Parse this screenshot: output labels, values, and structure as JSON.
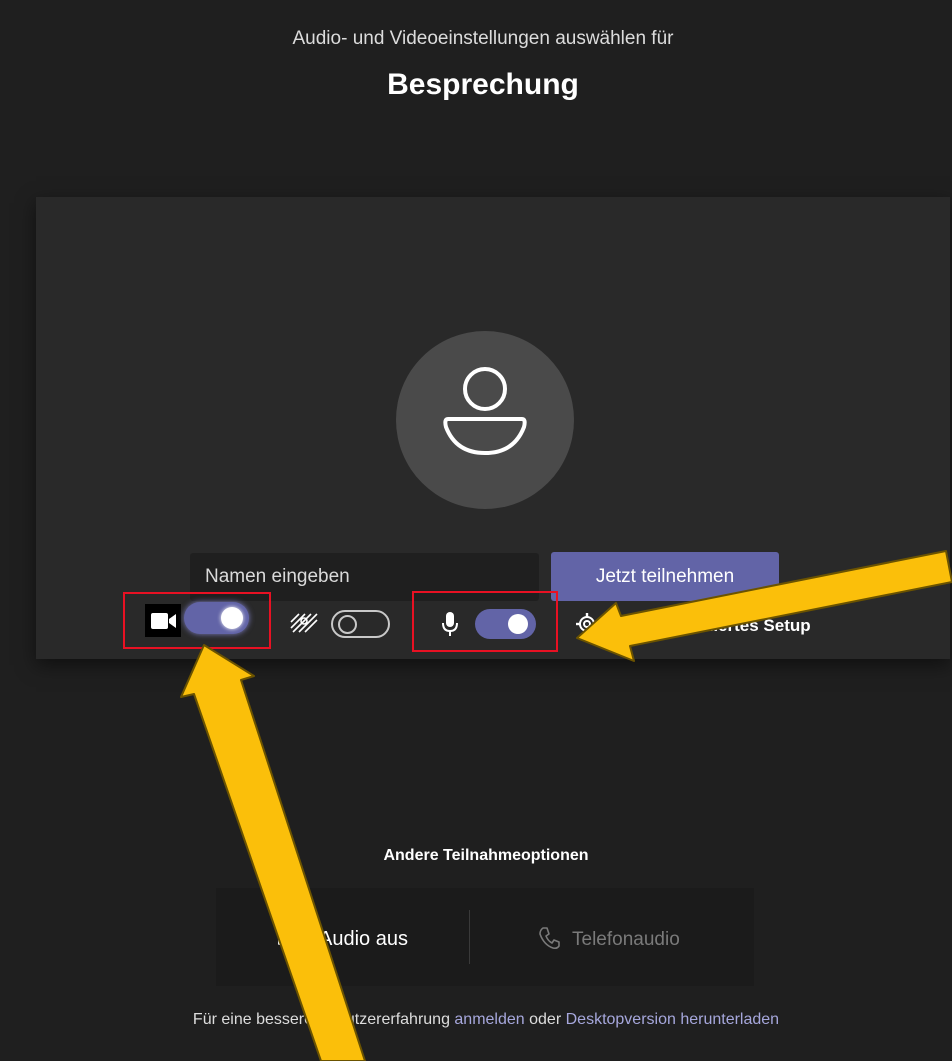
{
  "header": {
    "subtitle": "Audio- und Videoeinstellungen auswählen für",
    "title": "Besprechung"
  },
  "prejoin": {
    "name_placeholder": "Namen eingeben",
    "join_button": "Jetzt teilnehmen",
    "camera_toggle": {
      "icon": "video-camera-icon",
      "on": true
    },
    "background_toggle": {
      "icon": "background-effects-icon",
      "on": false
    },
    "mic_toggle": {
      "icon": "microphone-icon",
      "on": true
    },
    "device_settings": {
      "icon": "gear-icon",
      "label": "Benutzerdefiniertes Setup"
    }
  },
  "other_options": {
    "title": "Andere Teilnahmeoptionen",
    "audio_off": {
      "icon": "speaker-off-icon",
      "label": "Audio aus"
    },
    "phone_audio": {
      "icon": "phone-icon",
      "label": "Telefonaudio"
    }
  },
  "footer": {
    "prefix": "Für eine bessere Benutzererfahrung ",
    "signin_link": "anmelden",
    "middle": " oder ",
    "download_link": "Desktopversion herunterladen"
  },
  "colors": {
    "background": "#1f1f1f",
    "panel": "#292929",
    "accent": "#6264a7",
    "highlight_box": "#e81123",
    "arrow_fill": "#fbbf0a"
  }
}
